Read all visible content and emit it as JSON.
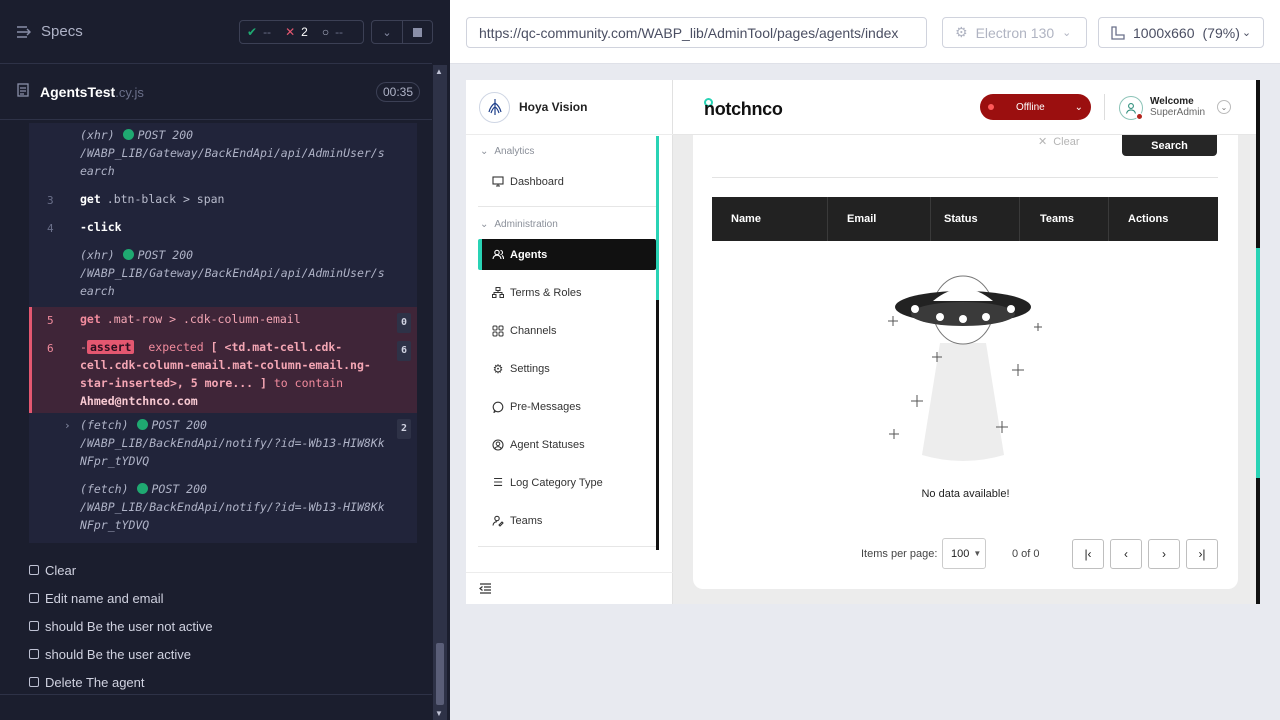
{
  "reporter": {
    "specs_label": "Specs",
    "stats": {
      "passed": "--",
      "failed": "2",
      "pending": "--"
    },
    "spec": {
      "name": "AgentsTest",
      "ext": ".cy.js",
      "duration": "00:35"
    },
    "commands": [
      {
        "kind": "xhr",
        "method": "POST",
        "status": "200",
        "url": "/WABP_LIB/Gateway/BackEndApi/api/AdminUser/search"
      },
      {
        "num": "3",
        "name": "get",
        "selector": ".btn-black > span"
      },
      {
        "num": "4",
        "name": "-click"
      },
      {
        "kind": "xhr",
        "method": "POST",
        "status": "200",
        "url": "/WABP_LIB/Gateway/BackEndApi/api/AdminUser/search"
      },
      {
        "num": "5",
        "name": "get",
        "selector": ".mat-row > .cdk-column-email",
        "badge": "0"
      },
      {
        "num": "6",
        "dash": "-",
        "tag": "assert",
        "pre": "expected",
        "body": "[ <td.mat-cell.cdk-cell.cdk-column-email.mat-column-email.ng-star-inserted>, 5 more... ]",
        "mid": "to contain",
        "email": "Ahmed@ntchnco.com",
        "badge": "6"
      },
      {
        "kind": "fetch",
        "method": "POST",
        "status": "200",
        "url": "/WABP_LIB/BackEndApi/notify/?id=-Wb13-HIW8KkNFpr_tYDVQ",
        "badge": "2"
      },
      {
        "kind": "fetch",
        "method": "POST",
        "status": "200",
        "url": "/WABP_LIB/BackEndApi/notify/?id=-Wb13-HIW8KkNFpr_tYDVQ"
      }
    ],
    "tests": [
      "Clear",
      "Edit name and email",
      "should Be the user not active",
      "should Be the user active",
      "Delete The agent"
    ]
  },
  "aut": {
    "url": "https://qc-community.com/WABP_lib/AdminTool/pages/agents/index",
    "browser": "Electron 130",
    "viewport": "1000x660",
    "zoom": "(79%)"
  },
  "app": {
    "brand": "Hoya Vision",
    "logo": "notchnco",
    "status": "Offline",
    "welcome": "Welcome",
    "role": "SuperAdmin",
    "nav": {
      "analytics": "Analytics",
      "dashboard": "Dashboard",
      "administration": "Administration",
      "agents": "Agents",
      "terms": "Terms & Roles",
      "channels": "Channels",
      "settings": "Settings",
      "premessages": "Pre-Messages",
      "agent_statuses": "Agent Statuses",
      "log_category": "Log Category Type",
      "teams": "Teams"
    },
    "actions": {
      "clear": "Clear",
      "search": "Search"
    },
    "columns": [
      "Name",
      "Email",
      "Status",
      "Teams",
      "Actions"
    ],
    "empty": "No data available!",
    "pager": {
      "label": "Items per page:",
      "size": "100",
      "count": "0 of 0"
    }
  },
  "colors": {
    "accent": "#29d3b5",
    "error": "#e45770",
    "offline": "#9b0f0f"
  }
}
